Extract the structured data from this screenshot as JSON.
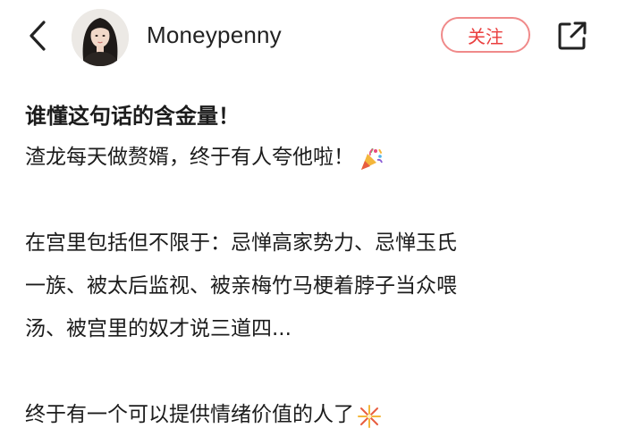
{
  "header": {
    "username": "Moneypenny",
    "follow_label": "关注"
  },
  "post": {
    "title": "谁懂这句话的含金量！",
    "line1": "渣龙每天做赘婿，终于有人夸他啦！",
    "line1_emoji": "party-popper-icon",
    "para2": [
      "在宫里包括但不限于：忌惮高家势力、忌惮玉氏",
      "一族、被太后监视、被亲梅竹马梗着脖子当众喂",
      "汤、被宫里的奴才说三道四..."
    ],
    "line_last": "终于有一个可以提供情绪价值的人了",
    "line_last_emoji": "fireworks-icon"
  },
  "colors": {
    "accent_red": "#ea3f3f",
    "follow_border": "#f08a8a",
    "text": "#1c1c1c"
  }
}
